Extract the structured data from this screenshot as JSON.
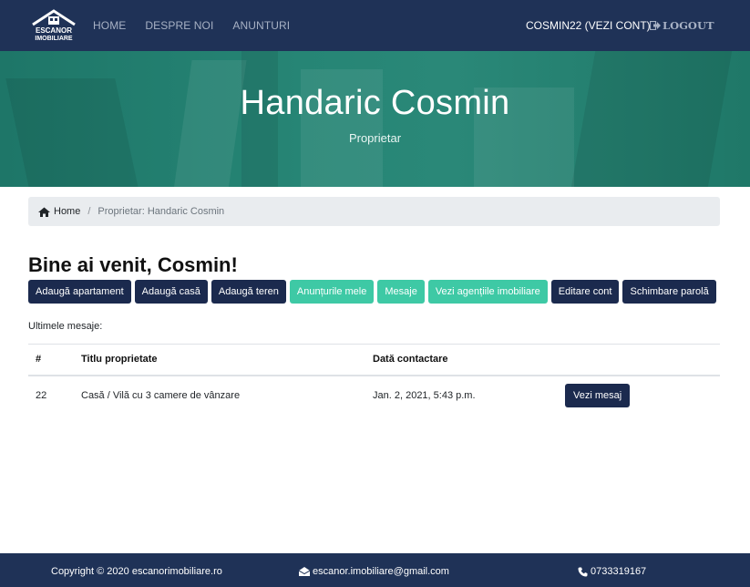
{
  "navbar": {
    "logo_text_line1": "ESCANOR",
    "logo_text_line2": "IMOBILIARE",
    "links": [
      {
        "label": "HOME"
      },
      {
        "label": "DESPRE NOI"
      },
      {
        "label": "ANUNTURI"
      }
    ],
    "account_label": "COSMIN22 (VEZI CONT)",
    "logout_label": "LOGOUT"
  },
  "hero": {
    "title": "Handaric Cosmin",
    "subtitle": "Proprietar"
  },
  "breadcrumb": {
    "home_label": "Home",
    "current": "Proprietar: Handaric Cosmin"
  },
  "welcome": "Bine ai venit, Cosmin!",
  "actions": [
    {
      "label": "Adaugă apartament",
      "style": "dark"
    },
    {
      "label": "Adaugă casă",
      "style": "dark"
    },
    {
      "label": "Adaugă teren",
      "style": "dark"
    },
    {
      "label": "Anunțurile mele",
      "style": "teal"
    },
    {
      "label": "Mesaje",
      "style": "teal"
    },
    {
      "label": "Vezi agențiile imobiliare",
      "style": "teal"
    },
    {
      "label": "Editare cont",
      "style": "dark"
    },
    {
      "label": "Schimbare parolă",
      "style": "dark"
    }
  ],
  "recent_label": "Ultimele mesaje:",
  "table": {
    "headers": [
      "#",
      "Titlu proprietate",
      "Dată contactare",
      ""
    ],
    "rows": [
      {
        "id": "22",
        "title": "Casă / Vilă cu 3 camere de vânzare",
        "date": "Jan. 2, 2021, 5:43 p.m.",
        "action": "Vezi mesaj"
      }
    ]
  },
  "footer": {
    "copyright": "Copyright © 2020 escanorimobiliare.ro",
    "email": "escanor.imobiliare@gmail.com",
    "phone": "0733319167"
  },
  "colors": {
    "navbar": "#1f3257",
    "hero": "#268575",
    "button_dark": "#1b2a4e",
    "button_teal": "#3ec9a5"
  }
}
